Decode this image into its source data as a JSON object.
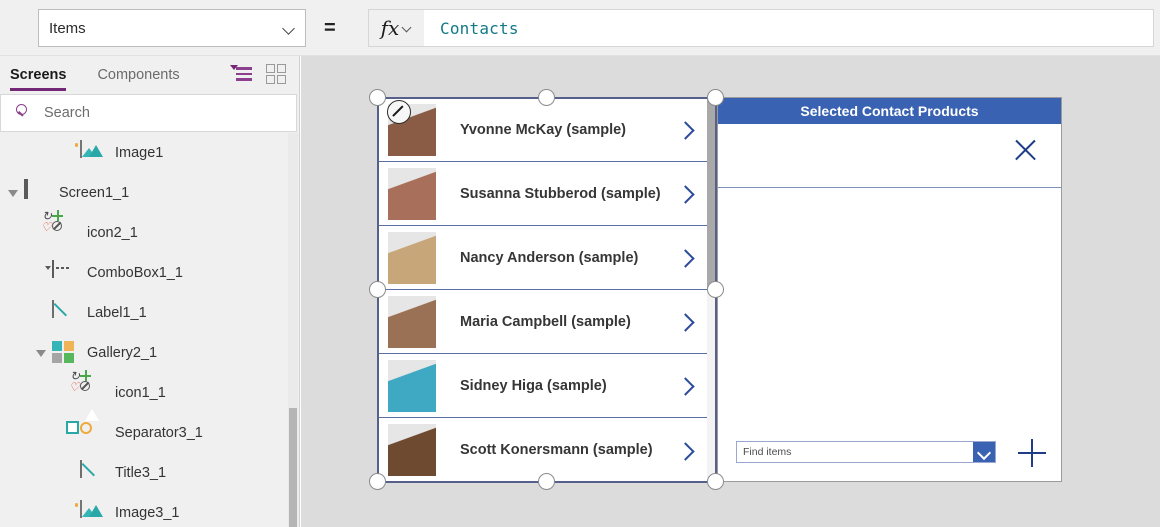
{
  "formula_bar": {
    "property_label": "Items",
    "equals": "=",
    "fx_label": "fx",
    "formula_value": "Contacts"
  },
  "left_panel": {
    "tabs": [
      {
        "label": "Screens",
        "active": true
      },
      {
        "label": "Components",
        "active": false
      }
    ],
    "view_icons": [
      {
        "name": "tree-view-icon"
      },
      {
        "name": "grid-view-icon"
      }
    ],
    "search": {
      "placeholder": "Search"
    },
    "tree": [
      {
        "label": "Image1",
        "icon": "image-icon",
        "indent": 2,
        "expander": "none"
      },
      {
        "label": "Screen1_1",
        "icon": "screen-icon",
        "indent": 0,
        "expander": "expanded"
      },
      {
        "label": "icon2_1",
        "icon": "icon-set-icon",
        "indent": 1,
        "expander": "none"
      },
      {
        "label": "ComboBox1_1",
        "icon": "combobox-icon",
        "indent": 1,
        "expander": "none"
      },
      {
        "label": "Label1_1",
        "icon": "label-icon",
        "indent": 1,
        "expander": "none"
      },
      {
        "label": "Gallery2_1",
        "icon": "gallery-icon",
        "indent": 1,
        "expander": "expanded"
      },
      {
        "label": "icon1_1",
        "icon": "icon-set-icon",
        "indent": 2,
        "expander": "none"
      },
      {
        "label": "Separator3_1",
        "icon": "shapes-icon",
        "indent": 2,
        "expander": "none"
      },
      {
        "label": "Title3_1",
        "icon": "label-icon",
        "indent": 2,
        "expander": "none"
      },
      {
        "label": "Image3_1",
        "icon": "image-icon",
        "indent": 2,
        "expander": "none"
      }
    ]
  },
  "canvas": {
    "gallery": {
      "rows": [
        {
          "name": "Yvonne McKay (sample)",
          "avatar": "#8a5c46"
        },
        {
          "name": "Susanna Stubberod (sample)",
          "avatar": "#a8705a"
        },
        {
          "name": "Nancy Anderson (sample)",
          "avatar": "#c7a77a"
        },
        {
          "name": "Maria Campbell (sample)",
          "avatar": "#9b7156"
        },
        {
          "name": "Sidney Higa (sample)",
          "avatar": "#3fa9c4"
        },
        {
          "name": "Scott Konersmann (sample)",
          "avatar": "#6e4a30"
        }
      ],
      "chevron_icon": "chevron-right-icon",
      "edit_badge_icon": "edit-pencil-icon"
    },
    "form_panel": {
      "title": "Selected Contact Products",
      "close_icon": "close-x-icon",
      "add_icon": "plus-icon",
      "combobox": {
        "placeholder": "Find items",
        "dropdown_icon": "chevron-down-icon"
      }
    }
  },
  "colors": {
    "accent_purple": "#742774",
    "formula_teal": "#117a86",
    "panel_blue": "#3a62b2",
    "selection_blue": "#57608a",
    "canvas_bg": "#dcdcdc"
  }
}
